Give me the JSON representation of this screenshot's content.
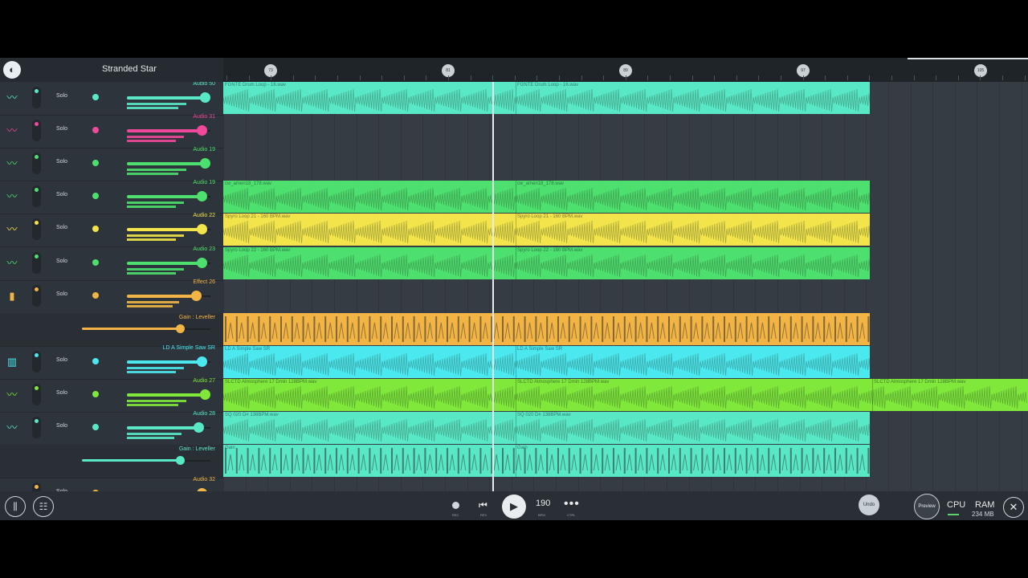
{
  "app": {
    "project_title": "Stranded Star",
    "logo": "fl-studio-logo"
  },
  "timeline": {
    "markers": [
      "73",
      "81",
      "89",
      "97",
      "105"
    ]
  },
  "tracks": [
    {
      "name": "Audio 50",
      "solo": "Solo",
      "color": "#59e8c6",
      "icon": "waveform-icon",
      "volume": 0.94,
      "pan": 0.5,
      "kind": "audio"
    },
    {
      "name": "Audio 31",
      "solo": "Solo",
      "color": "#f0489a",
      "icon": "waveform-icon",
      "volume": 0.9,
      "pan": 0.5,
      "kind": "audio"
    },
    {
      "name": "Audio 19",
      "solo": "Solo",
      "color": "#4ee06e",
      "icon": "waveform-icon",
      "volume": 0.94,
      "pan": 0.5,
      "kind": "audio"
    },
    {
      "name": "Audio 19",
      "solo": "Solo",
      "color": "#4ee06e",
      "icon": "waveform-icon",
      "volume": 0.9,
      "pan": 0.5,
      "kind": "audio"
    },
    {
      "name": "Audio 22",
      "solo": "Solo",
      "color": "#f2e44a",
      "icon": "waveform-icon",
      "volume": 0.9,
      "pan": 0.5,
      "kind": "audio"
    },
    {
      "name": "Audio 23",
      "solo": "Solo",
      "color": "#4ee06e",
      "icon": "waveform-icon",
      "volume": 0.9,
      "pan": 0.5,
      "kind": "audio"
    },
    {
      "name": "Effect 26",
      "solo": "Solo",
      "color": "#f2b545",
      "icon": "bars-icon",
      "volume": 0.84,
      "pan": 0.5,
      "kind": "audio"
    },
    {
      "name": "Gain : Leveller",
      "color": "#f2b545",
      "volume": 0.76,
      "kind": "gain"
    },
    {
      "name": "LD A Simple Saw SR",
      "solo": "Solo",
      "color": "#4be8f0",
      "icon": "keys-icon",
      "volume": 0.9,
      "pan": 0.5,
      "kind": "audio"
    },
    {
      "name": "Audio 27",
      "solo": "Solo",
      "color": "#7fe83a",
      "icon": "waveform-icon",
      "volume": 0.94,
      "pan": 0.5,
      "kind": "audio"
    },
    {
      "name": "Audio 28",
      "solo": "Solo",
      "color": "#59e8c6",
      "icon": "waveform-icon",
      "volume": 0.87,
      "pan": 0.5,
      "kind": "audio"
    },
    {
      "name": "Gain : Leveller",
      "color": "#59e8c6",
      "volume": 0.76,
      "kind": "gain"
    },
    {
      "name": "Audio 32",
      "solo": "Solo",
      "color": "#f2b545",
      "icon": "waveform-icon",
      "volume": 0.9,
      "pan": 0.5,
      "kind": "audio"
    }
  ],
  "clips": [
    {
      "row": 0,
      "labels": [
        "FGNTE Drum Loop - 16.wav",
        "FGNTE Drum Loop - 16.wav"
      ],
      "color": "#59e8c6",
      "end": 1083
    },
    {
      "row": 3,
      "labels": [
        "cw_amen18_178.wav",
        "cw_amen18_178.wav"
      ],
      "color": "#4ee06e",
      "end": 1083
    },
    {
      "row": 4,
      "labels": [
        "Spyro Loop 21 - 160 BPM.wav",
        "Spyro Loop 21 - 160 BPM.wav"
      ],
      "color": "#f2e44a",
      "end": 1083
    },
    {
      "row": 5,
      "labels": [
        "Spyro Loop 22 - 160 BPM.wav",
        "Spyro Loop 22 - 160 BPM.wav"
      ],
      "color": "#4ee06e",
      "end": 1083
    },
    {
      "row": 7,
      "labels": [],
      "color": "#f2b545",
      "end": 1083,
      "pattern": "automation"
    },
    {
      "row": 8,
      "labels": [
        "LD A Simple Saw SR",
        "LD A Simple Saw SR"
      ],
      "color": "#4be8f0",
      "end": 1083
    },
    {
      "row": 9,
      "labels": [
        "SLCTD Atmosphere 17 Dmin 128BPM.wav",
        "SLCTD Atmosphere 17 Dmin 128BPM.wav",
        "SLCTD Atmosphere 17 Dmin 128BPM.wav"
      ],
      "color": "#7fe83a",
      "end": 1280
    },
    {
      "row": 10,
      "labels": [
        "SQ 020 D# 138BPM.wav",
        "SQ 020 D# 138BPM.wav"
      ],
      "color": "#59e8c6",
      "end": 1083
    },
    {
      "row": 11,
      "labels": [
        "Gain",
        "Gain"
      ],
      "color": "#59e8c6",
      "end": 1083,
      "pattern": "automation"
    }
  ],
  "transport": {
    "rec_label": "REC",
    "rev_label": "REV",
    "bpm_value": "190",
    "bpm_label": "BPM",
    "ctrl_label": "CTRL"
  },
  "bottom": {
    "undo_label": "Undo",
    "preview_label": "Preview",
    "cpu_label": "CPU",
    "ram_label": "RAM",
    "ram_value": "234 MB"
  },
  "colors": {
    "background": "#2b3138",
    "accent": "#e9edf0"
  }
}
